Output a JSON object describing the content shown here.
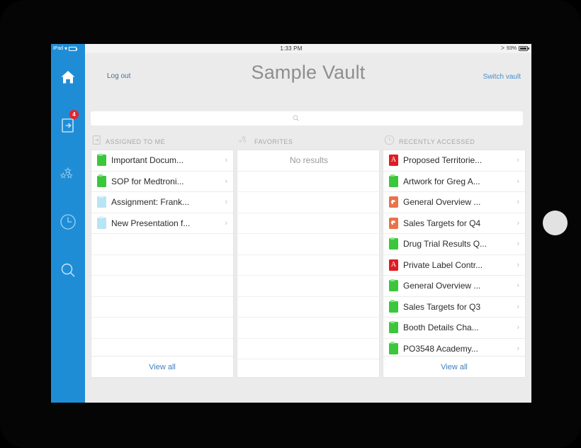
{
  "status_bar": {
    "carrier": "iPad",
    "wifi_icon": "wifi-icon",
    "time": "1:33 PM",
    "bluetooth_icon": "bluetooth-icon",
    "battery_percent": "93%",
    "battery_icon": "battery-icon"
  },
  "sidebar": {
    "background_color": "#1f8dd6",
    "items": [
      {
        "name": "home",
        "icon": "home-icon",
        "badge": null
      },
      {
        "name": "assigned-to-me",
        "icon": "assigned-document-icon",
        "badge": "4"
      },
      {
        "name": "favorites",
        "icon": "stars-icon",
        "badge": null
      },
      {
        "name": "recent",
        "icon": "clock-icon",
        "badge": null
      },
      {
        "name": "search",
        "icon": "search-icon",
        "badge": null
      }
    ],
    "badge_color": "#e8242a"
  },
  "topbar": {
    "logout_label": "Log out",
    "title": "Sample Vault",
    "switch_vault_label": "Switch vault",
    "link_color": "#4a8ec9"
  },
  "search": {
    "value": "",
    "placeholder": "",
    "icon": "search-icon"
  },
  "columns": [
    {
      "id": "assigned-to-me",
      "header": "ASSIGNED TO ME",
      "header_icon": "assigned-document-icon",
      "empty_message": null,
      "items": [
        {
          "label": "Important Docum...",
          "type": "xls",
          "chevron": "›"
        },
        {
          "label": "SOP for Medtroni...",
          "type": "xls",
          "chevron": "›"
        },
        {
          "label": "Assignment: Frank...",
          "type": "doc",
          "chevron": "›"
        },
        {
          "label": "New Presentation f...",
          "type": "doc",
          "chevron": "›"
        }
      ],
      "empty_rows": 6,
      "footer_label": "View all"
    },
    {
      "id": "favorites",
      "header": "FAVORITES",
      "header_icon": "stars-icon",
      "empty_message": "No results",
      "items": [],
      "empty_rows": 9,
      "footer_label": null
    },
    {
      "id": "recently-accessed",
      "header": "RECENTLY ACCESSED",
      "header_icon": "clock-icon",
      "empty_message": null,
      "items": [
        {
          "label": "Proposed Territorie...",
          "type": "pdf",
          "chevron": "›"
        },
        {
          "label": "Artwork for Greg A...",
          "type": "xls",
          "chevron": "›"
        },
        {
          "label": "General Overview ...",
          "type": "ppt",
          "chevron": "›"
        },
        {
          "label": "Sales Targets for Q4",
          "type": "ppt",
          "chevron": "›"
        },
        {
          "label": "Drug Trial Results Q...",
          "type": "xls",
          "chevron": "›"
        },
        {
          "label": "Private Label Contr...",
          "type": "pdf",
          "chevron": "›"
        },
        {
          "label": "General Overview ...",
          "type": "xls",
          "chevron": "›"
        },
        {
          "label": "Sales Targets for Q3",
          "type": "xls",
          "chevron": "›"
        },
        {
          "label": "Booth Details Cha...",
          "type": "xls",
          "chevron": "›"
        },
        {
          "label": "PO3548 Academy...",
          "type": "xls",
          "chevron": "›"
        }
      ],
      "empty_rows": 0,
      "footer_label": "View all"
    }
  ]
}
